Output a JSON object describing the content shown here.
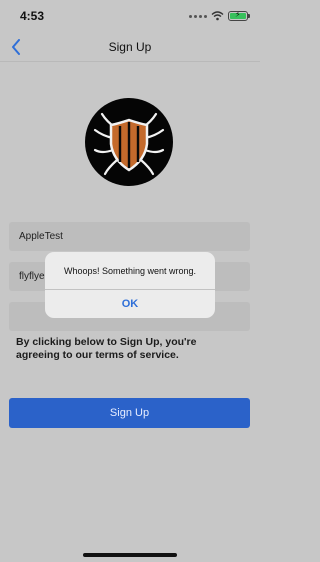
{
  "status_bar": {
    "time": "4:53",
    "battery_color": "#37c15c"
  },
  "nav": {
    "title": "Sign Up",
    "back_icon": "chevron-left-icon"
  },
  "form": {
    "username_value": "AppleTest",
    "email_value": "flyflye",
    "password_value": "",
    "terms_text": "By clicking below to Sign Up, you're agreeing to our terms of service.",
    "submit_label": "Sign Up"
  },
  "alert": {
    "message": "Whoops! Something went wrong.",
    "ok_label": "OK"
  },
  "colors": {
    "accent": "#2b62c9",
    "alert_button": "#2f6fd8",
    "logo_orange": "#c46a2c"
  }
}
